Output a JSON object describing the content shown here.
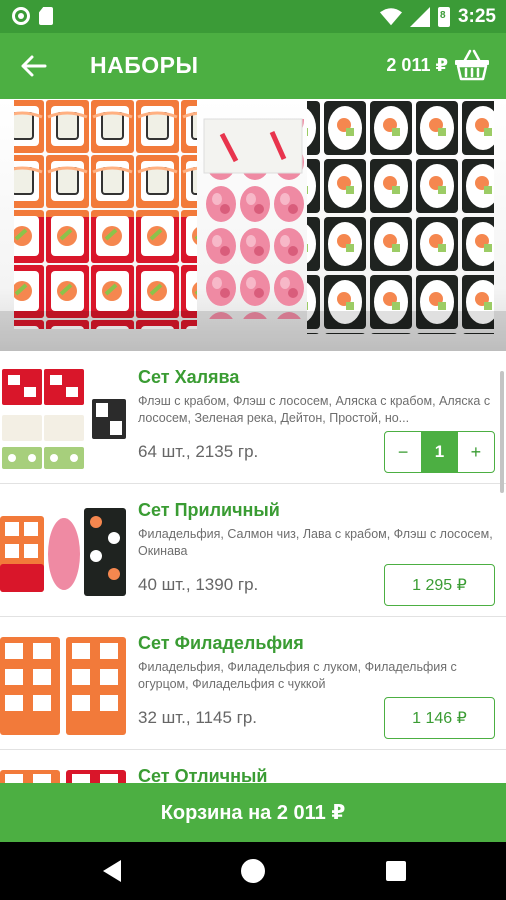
{
  "status_bar": {
    "time": "3:25",
    "battery_level": "8"
  },
  "app_bar": {
    "title": "НАБОРЫ",
    "cart_total": "2 011 ₽",
    "back_icon": "arrow-left-icon",
    "basket_icon": "basket-icon"
  },
  "colors": {
    "status_bar": "#3b9b37",
    "app_bar": "#4caf42",
    "accent_text": "#3a9c33",
    "meta_text": "#666666"
  },
  "products": [
    {
      "name": "Сет Халява",
      "description": "Флэш с крабом, Флэш с лососем, Аляска с крабом, Аляска с лососем, Зеленая река, Дейтон, Простой, но...",
      "meta": "64 шт., 2135 гр.",
      "in_cart": true,
      "quantity": "1",
      "minus_label": "−",
      "plus_label": "+"
    },
    {
      "name": "Сет Приличный",
      "description": "Филадельфия, Салмон чиз, Лава с крабом, Флэш с лососем, Окинава",
      "meta": "40 шт., 1390 гр.",
      "in_cart": false,
      "price": "1 295 ₽"
    },
    {
      "name": "Сет Филадельфия",
      "description": "Филадельфия, Филадельфия с луком, Филадельфия с огурцом, Филадельфия с чуккой",
      "meta": "32 шт., 1145 гр.",
      "in_cart": false,
      "price": "1 146 ₽"
    },
    {
      "name": "Сет Отличный"
    }
  ],
  "cart_bar": {
    "label": "Корзина на 2 011 ₽"
  }
}
